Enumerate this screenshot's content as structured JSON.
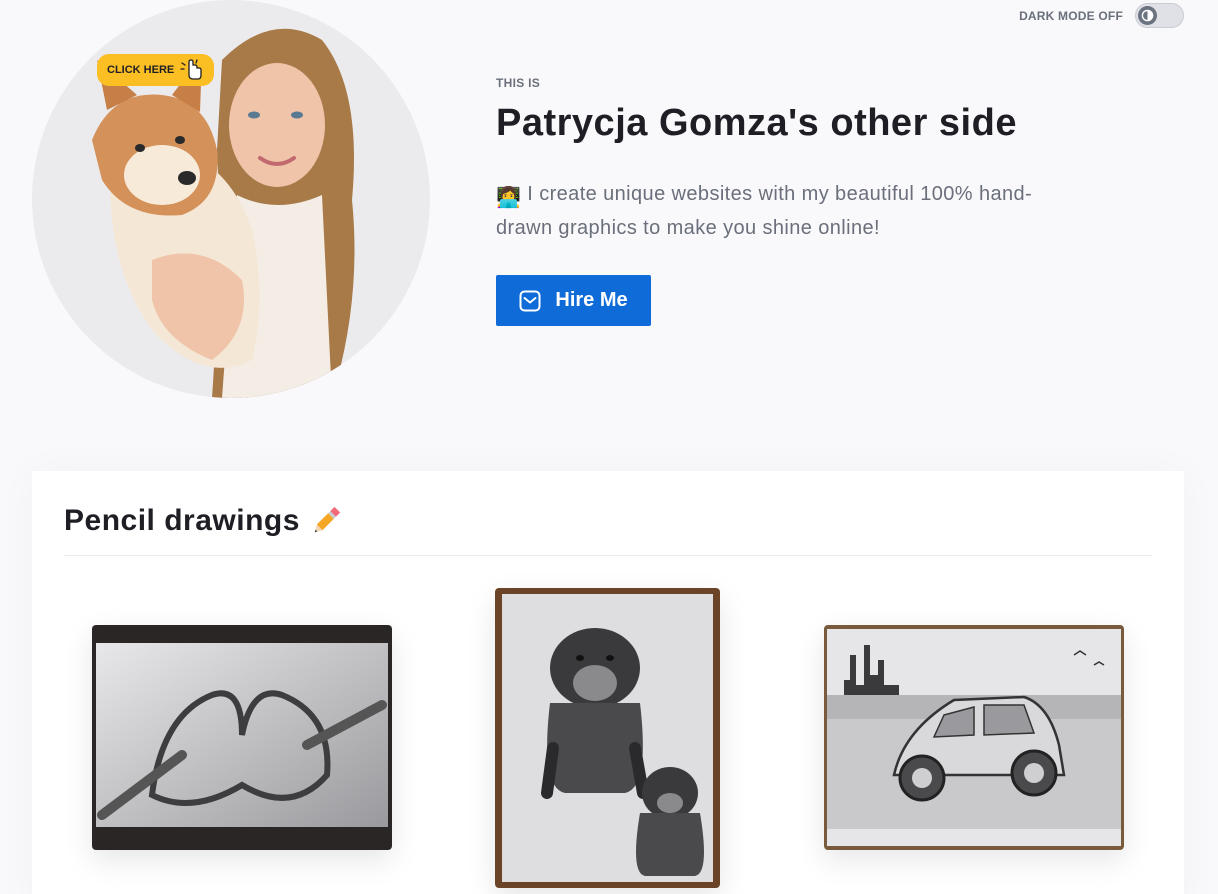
{
  "darkmode": {
    "label": "DARK MODE OFF",
    "enabled": false
  },
  "hero": {
    "badge": "CLICK HERE",
    "eyebrow": "THIS IS",
    "title": "Patrycja Gomza's other side",
    "emoji_1": "👩‍💻",
    "description": "I create unique websites with my beautiful 100% hand-drawn graphics to make you shine online!",
    "hire_label": "Hire Me",
    "hire_icon": "envelope-icon"
  },
  "gallery": {
    "title": "Pencil drawings",
    "title_icon": "pencil-icon",
    "drawings": [
      "hands-heart-drawing",
      "dogs-drawing",
      "car-drawing"
    ]
  },
  "colors": {
    "accent": "#0f6bd7",
    "badge": "#fbbf24",
    "text_primary": "#1e1e24",
    "text_muted": "#6a6f7b",
    "background": "#f9f9fc"
  }
}
